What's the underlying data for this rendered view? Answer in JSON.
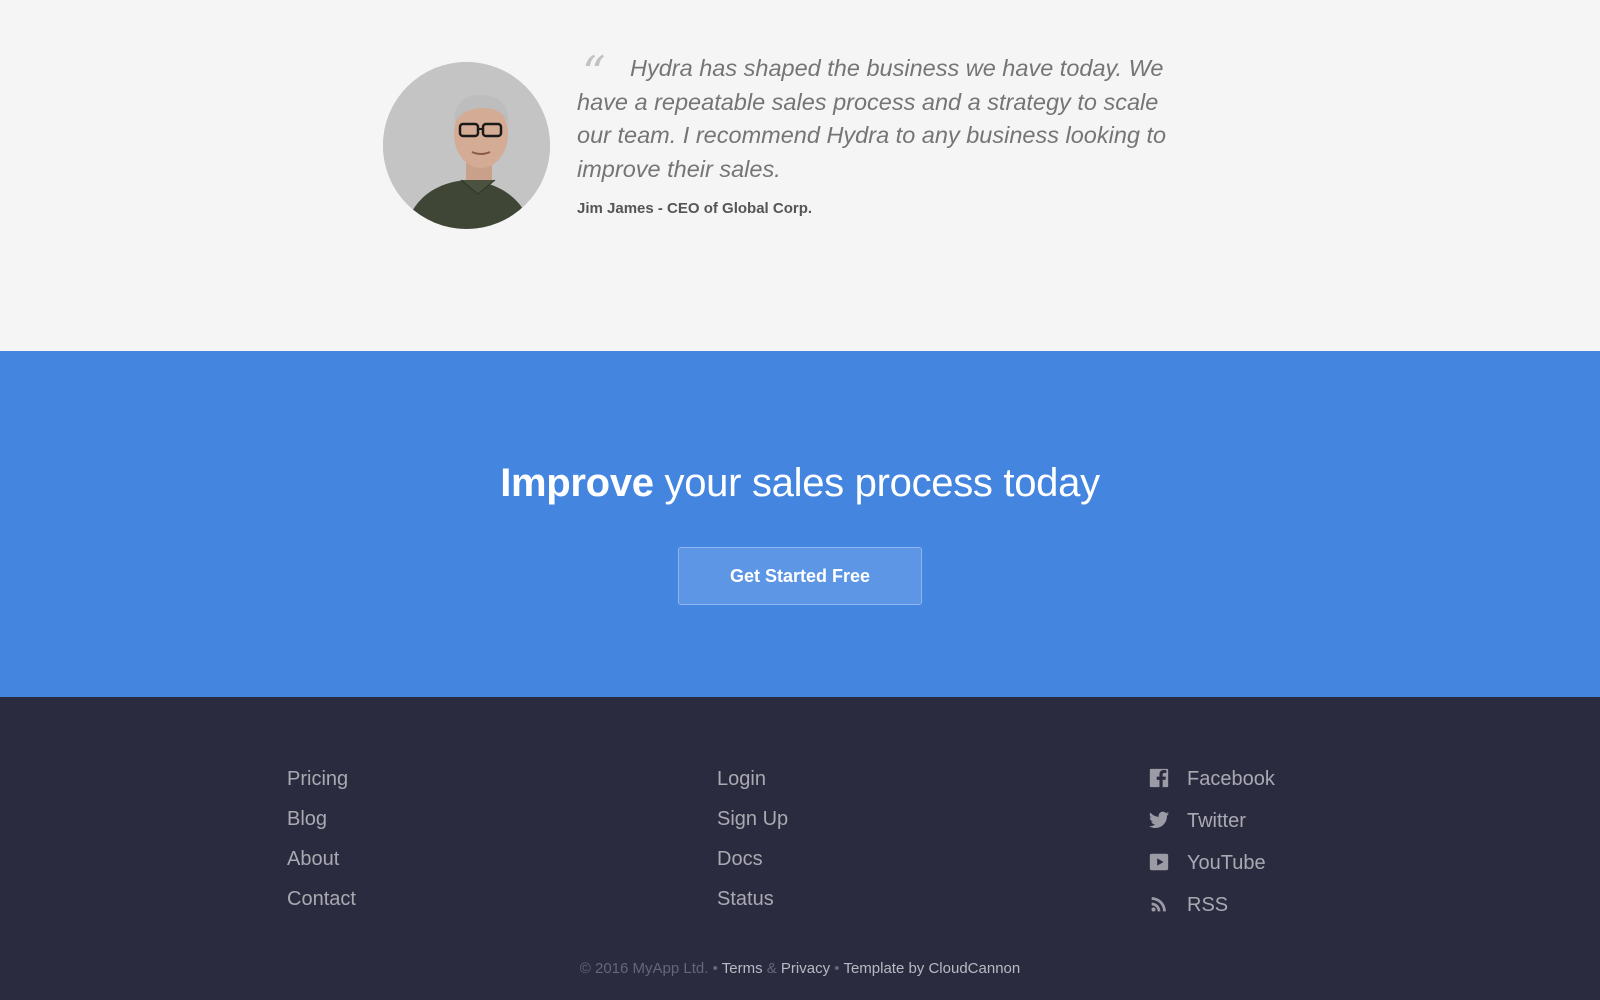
{
  "testimonial": {
    "quote_mark": "“",
    "quote": "Hydra has shaped the business we have today. We have a repeatable sales process and a strategy to scale our team. I recommend Hydra to any business looking to improve their sales.",
    "author": "Jim James - CEO of Global Corp."
  },
  "cta": {
    "heading_bold": "Improve",
    "heading_rest": " your sales process today",
    "button_label": "Get Started Free"
  },
  "footer": {
    "col1": [
      "Pricing",
      "Blog",
      "About",
      "Contact"
    ],
    "col2": [
      "Login",
      "Sign Up",
      "Docs",
      "Status"
    ],
    "social": [
      {
        "label": "Facebook",
        "icon": "facebook-icon"
      },
      {
        "label": "Twitter",
        "icon": "twitter-icon"
      },
      {
        "label": "YouTube",
        "icon": "youtube-icon"
      },
      {
        "label": "RSS",
        "icon": "rss-icon"
      }
    ],
    "copyright": "© 2016 MyApp Ltd.",
    "bullet": " • ",
    "terms": "Terms",
    "amp": " & ",
    "privacy": "Privacy",
    "template_by": "Template by CloudCannon"
  },
  "colors": {
    "cta_background": "#4485e0",
    "footer_background": "#2b2b40",
    "page_background": "#f5f5f5"
  }
}
